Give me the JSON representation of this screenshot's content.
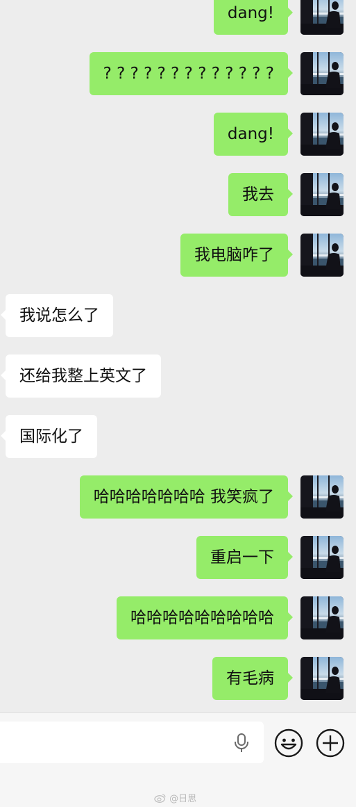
{
  "messages": [
    {
      "side": "out",
      "text": "dang!"
    },
    {
      "side": "out",
      "text": "? ? ? ? ? ? ? ? ? ? ? ? ?"
    },
    {
      "side": "out",
      "text": "dang!"
    },
    {
      "side": "out",
      "text": "我去"
    },
    {
      "side": "out",
      "text": "我电脑咋了"
    },
    {
      "side": "in",
      "text": "我说怎么了"
    },
    {
      "side": "in",
      "text": "还给我整上英文了"
    },
    {
      "side": "in",
      "text": "国际化了"
    },
    {
      "side": "out",
      "text": "哈哈哈哈哈哈哈 我笑疯了"
    },
    {
      "side": "out",
      "text": "重启一下"
    },
    {
      "side": "out",
      "text": "哈哈哈哈哈哈哈哈哈"
    },
    {
      "side": "out",
      "text": "有毛病"
    }
  ],
  "input_bar": {
    "text_value": "",
    "icons": [
      "microphone-icon",
      "emoji-icon",
      "plus-icon"
    ]
  },
  "watermark": {
    "text": "@日思"
  },
  "colors": {
    "background": "#ededed",
    "outgoing_bubble": "#95ec69",
    "incoming_bubble": "#ffffff",
    "input_bar": "#f6f6f6"
  }
}
